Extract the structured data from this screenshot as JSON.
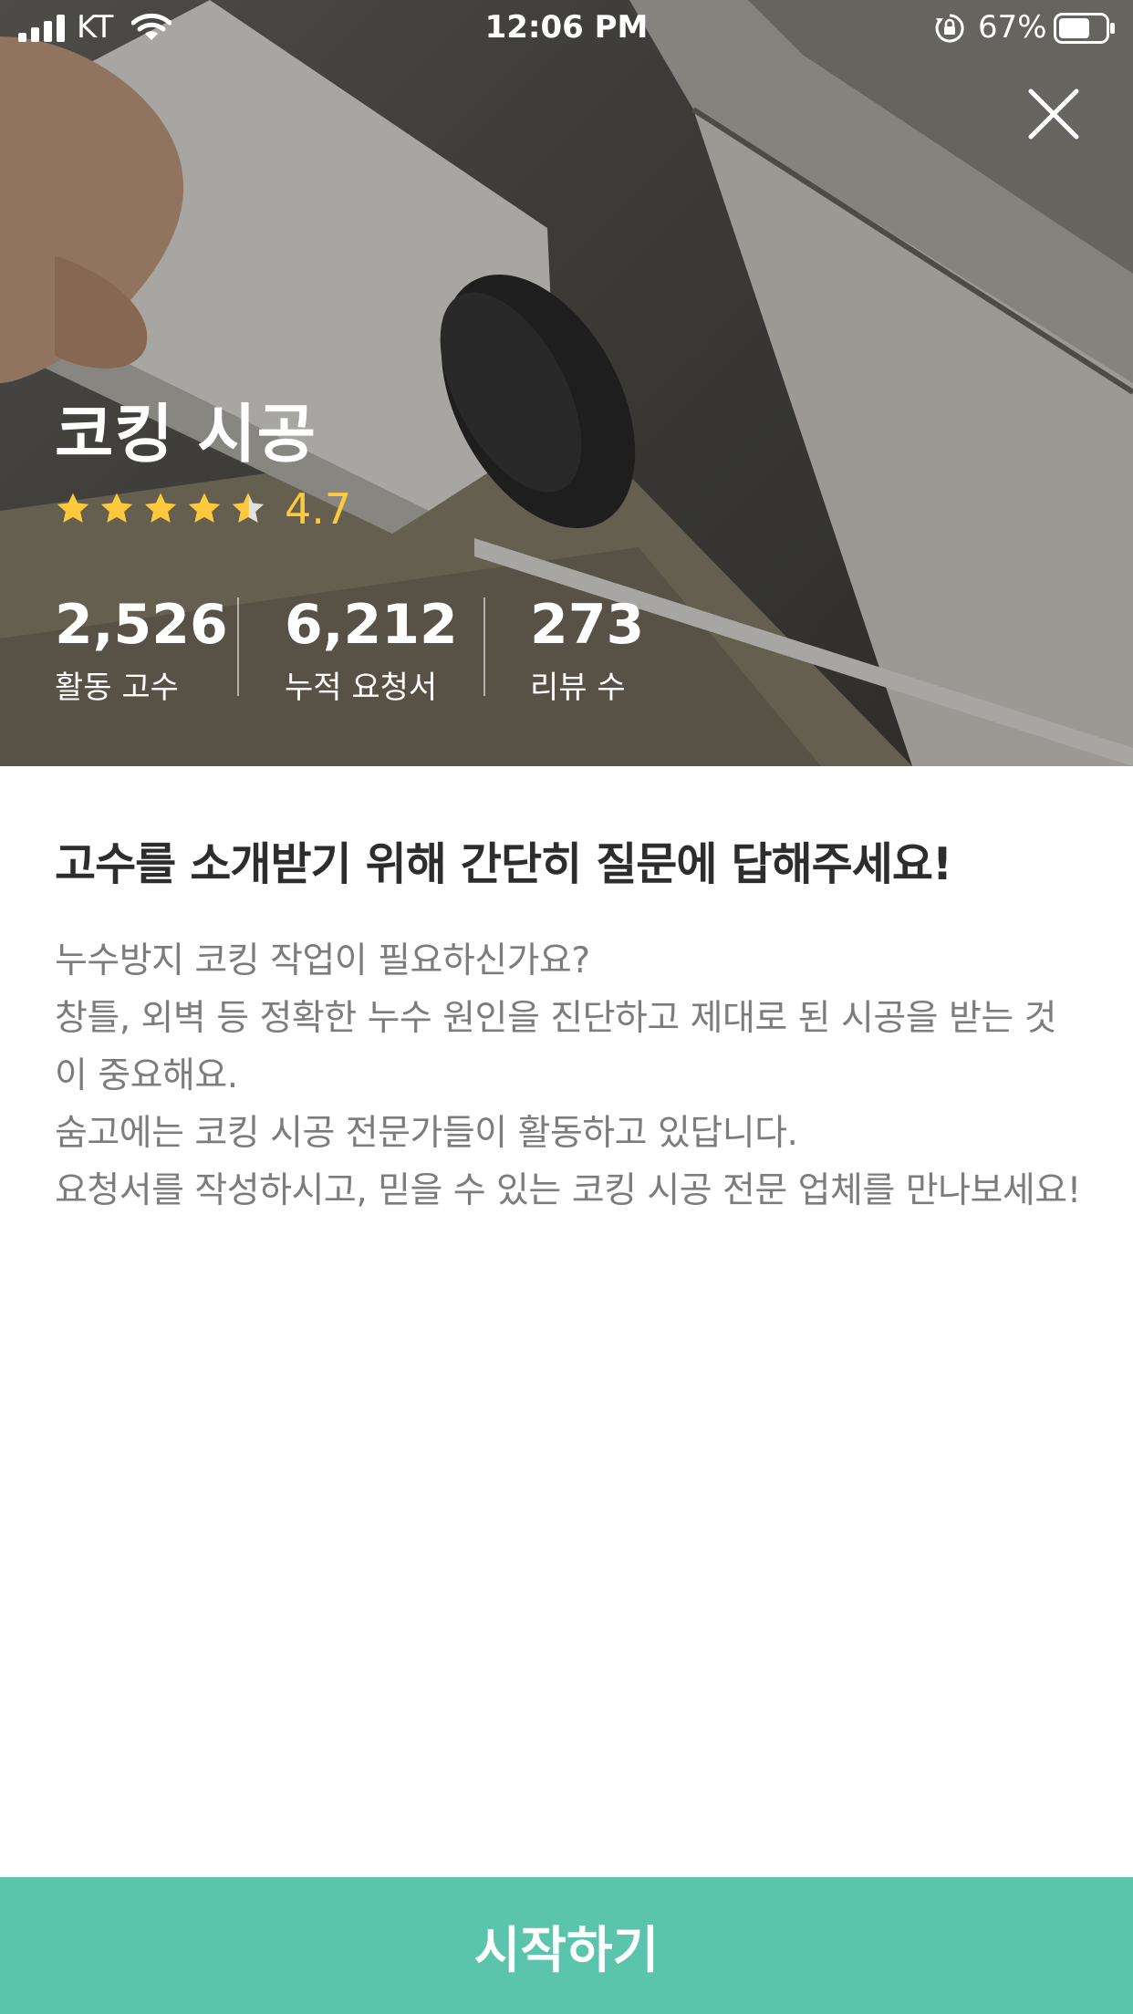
{
  "status_bar": {
    "carrier": "KT",
    "time": "12:06 PM",
    "battery": "67%",
    "battery_level": 0.67
  },
  "hero": {
    "title": "코킹 시공",
    "rating": 4.7,
    "rating_text": "4.7",
    "rating_color": "#ffc93c",
    "stats": [
      {
        "value": "2,526",
        "label": "활동 고수"
      },
      {
        "value": "6,212",
        "label": "누적 요청서"
      },
      {
        "value": "273",
        "label": "리뷰 수"
      }
    ]
  },
  "content": {
    "headline": "고수를 소개받기 위해 간단히 질문에 답해주세요!",
    "description_lines": [
      "누수방지 코킹 작업이 필요하신가요?",
      "창틀, 외벽 등 정확한 누수 원인을 진단하고 제대로 된 시공을 받는 것이 중요해요.",
      "숨고에는 코킹 시공 전문가들이 활동하고 있답니다.",
      "요청서를 작성하시고, 믿을 수 있는 코킹 시공 전문 업체를 만나보세요!"
    ]
  },
  "cta": {
    "label": "시작하기",
    "color": "#5bc4ad"
  },
  "icons": {
    "close": "close-icon",
    "star": "star-icon",
    "signal": "signal-icon",
    "wifi": "wifi-icon",
    "rotation_lock": "rotation-lock-icon",
    "battery": "battery-icon"
  }
}
